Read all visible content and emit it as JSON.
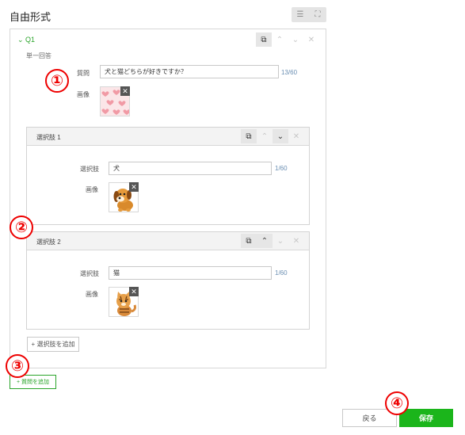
{
  "header": {
    "title": "自由形式"
  },
  "view_toggle": {
    "list_icon": "☰",
    "expand_icon": "⛶"
  },
  "question": {
    "toggle_label": "⌄ Q1",
    "type": "単一回答",
    "field_label": "質問",
    "value": "犬と猫どちらが好きですか？",
    "counter": "13/60",
    "image_label": "画像",
    "image_name": "pink-hearts-pattern"
  },
  "choices": [
    {
      "title": "選択肢 1",
      "field_label": "選択肢",
      "value": "犬",
      "counter": "1/60",
      "image_label": "画像",
      "image_name": "puppy-illustration"
    },
    {
      "title": "選択肢 2",
      "field_label": "選択肢",
      "value": "猫",
      "counter": "1/60",
      "image_label": "画像",
      "image_name": "kitten-illustration"
    }
  ],
  "toolbar_icons": {
    "copy": "⧉",
    "up": "⌃",
    "down": "⌄",
    "close": "✕"
  },
  "add_choice_label": "+ 選択肢を追加",
  "add_question_label": "+ 質問を追加",
  "footer": {
    "back_label": "戻る",
    "save_label": "保存"
  },
  "markers": [
    "①",
    "②",
    "③",
    "④"
  ],
  "colors": {
    "accent_green": "#1bb51b",
    "marker_red": "#e00000",
    "counter_blue": "#6b8fb3"
  }
}
